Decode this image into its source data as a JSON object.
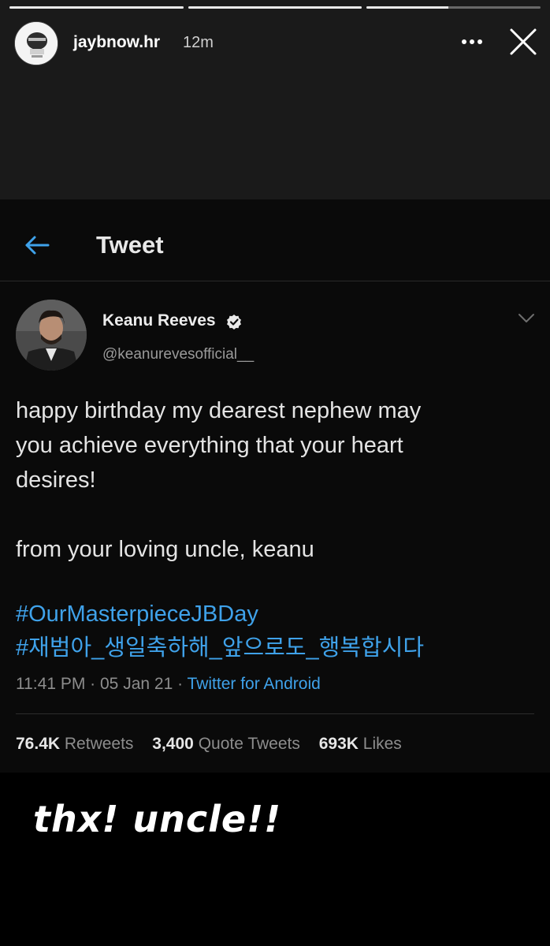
{
  "story": {
    "username": "jaybnow.hr",
    "time": "12m",
    "progress": [
      1.0,
      1.0,
      0.47
    ],
    "icons": {
      "avatar": "profile-avatar",
      "more": "more-dots-icon",
      "close": "close-icon"
    }
  },
  "tweet_page": {
    "title": "Tweet",
    "back_icon": "back-arrow-icon"
  },
  "tweet": {
    "name": "Keanu Reeves",
    "handle": "@keanurevesofficial__",
    "verified": true,
    "body_line1": "happy birthday my dearest nephew may",
    "body_line2": "you achieve everything that your heart",
    "body_line3": "desires!",
    "body_line4": "from your loving uncle, keanu",
    "hashtags": [
      "#OurMasterpieceJBDay",
      "#재범아_생일축하해_앞으로도_행복합시다"
    ],
    "time": "11:41 PM",
    "date": "05 Jan 21",
    "source": "Twitter for Android",
    "stats": {
      "retweets_count": "76.4K",
      "retweets_label": "Retweets",
      "quotes_count": "3,400",
      "quotes_label": "Quote Tweets",
      "likes_count": "693K",
      "likes_label": "Likes"
    },
    "colors": {
      "link": "#3fa2ea",
      "background": "#0a0a0a"
    }
  },
  "caption": "thx! uncle!!"
}
